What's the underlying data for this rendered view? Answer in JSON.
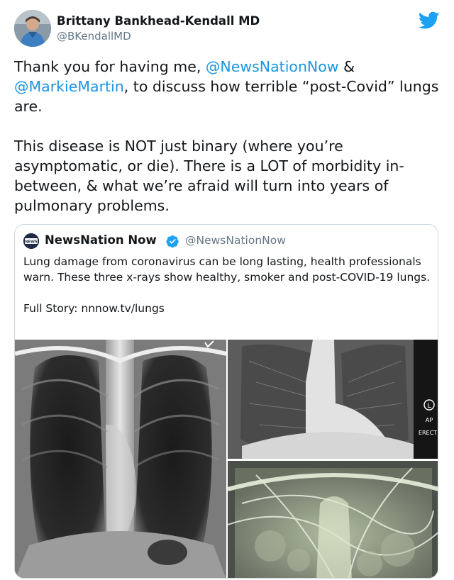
{
  "author": {
    "name": "Brittany Bankhead-Kendall MD",
    "handle": "@BKendallMD"
  },
  "tweet": {
    "para1": {
      "t1": "Thank you for having me, ",
      "m1": "@NewsNationNow",
      "t2": " & ",
      "m2": "@MarkieMartin",
      "t3": ", to discuss how terrible “post-Covid” lungs are."
    },
    "para2": "This disease is NOT just binary (where you’re asymptomatic, or die). There is a LOT of morbidity in-between, & what we’re afraid will turn into years of pulmonary problems."
  },
  "quoted": {
    "name": "NewsNation Now",
    "handle": "@NewsNationNow",
    "avatar_text": "NEWS",
    "text": "Lung damage from coronavirus can be long lasting, health professionals warn. These three x-rays show healthy, smoker and post-COVID-19 lungs.",
    "link_line": "Full Story: nnnow.tv/lungs"
  },
  "xray_markers": {
    "side": "L",
    "view": "AP",
    "position": "ERECT"
  },
  "colors": {
    "link": "#1b95e0",
    "twitter_blue": "#1da1f2",
    "handle_gray": "#657786",
    "border": "#ccd6dd"
  },
  "icons": {
    "brand": "twitter-bird-icon",
    "verified": "verified-badge-icon"
  }
}
